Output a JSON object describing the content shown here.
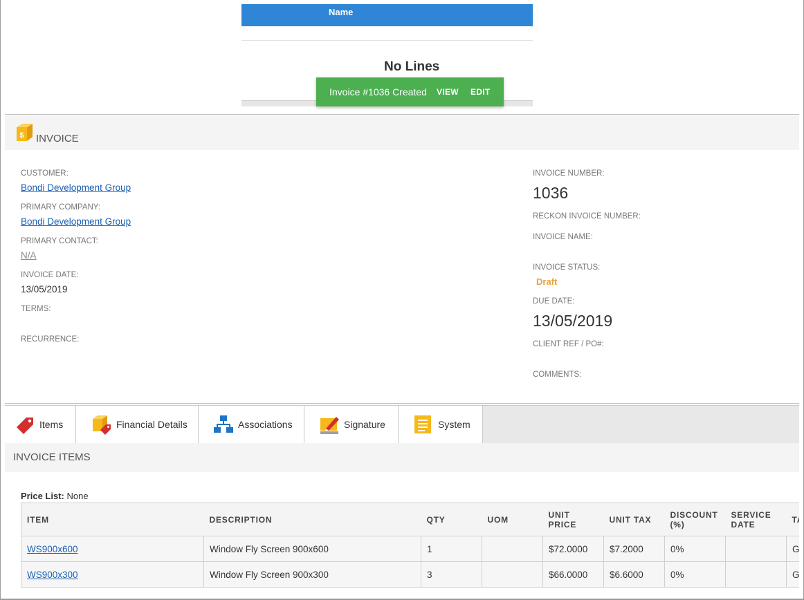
{
  "top_panel": {
    "name_header": "Name",
    "empty_message": "No Lines"
  },
  "toast": {
    "message": "Invoice #1036 Created",
    "view_label": "VIEW",
    "edit_label": "EDIT",
    "color": "#4caf50"
  },
  "invoice": {
    "section_title": "INVOICE",
    "icon": "invoice-box-icon",
    "left_fields": {
      "customer_label": "CUSTOMER:",
      "customer_value": "Bondi Development Group",
      "primary_company_label": "PRIMARY COMPANY:",
      "primary_company_value": "Bondi Development Group",
      "primary_contact_label": "PRIMARY CONTACT:",
      "primary_contact_value": "N/A",
      "invoice_date_label": "INVOICE DATE:",
      "invoice_date_value": "13/05/2019",
      "terms_label": "TERMS:",
      "recurrence_label": "RECURRENCE:"
    },
    "right_fields": {
      "invoice_number_label": "INVOICE NUMBER:",
      "invoice_number_value": "1036",
      "reckon_label": "RECKON INVOICE NUMBER:",
      "invoice_name_label": "INVOICE NAME:",
      "status_label": "INVOICE STATUS:",
      "status_value": "Draft",
      "status_color": "#e8a13a",
      "due_date_label": "DUE DATE:",
      "due_date_value": "13/05/2019",
      "client_ref_label": "CLIENT REF / PO#:",
      "comments_label": "COMMENTS:"
    }
  },
  "tabs": [
    {
      "label": "Items",
      "icon": "price-tag-icon",
      "active": true
    },
    {
      "label": "Financial Details",
      "icon": "financial-box-icon",
      "active": false
    },
    {
      "label": "Associations",
      "icon": "hierarchy-icon",
      "active": false
    },
    {
      "label": "Signature",
      "icon": "signature-pen-icon",
      "active": false
    },
    {
      "label": "System",
      "icon": "system-list-icon",
      "active": false
    }
  ],
  "items_section": {
    "title": "INVOICE ITEMS",
    "price_list_label": "Price List:",
    "price_list_value": "None",
    "columns": [
      "ITEM",
      "DESCRIPTION",
      "QTY",
      "UOM",
      "UNIT PRICE",
      "UNIT TAX",
      "DISCOUNT (%)",
      "SERVICE DATE",
      "TAX"
    ],
    "rows": [
      {
        "item": "WS900x600",
        "description": "Window Fly Screen 900x600",
        "qty": "1",
        "uom": "",
        "unit_price": "$72.0000",
        "unit_tax": "$7.2000",
        "discount": "0%",
        "service_date": "",
        "tax": "GST"
      },
      {
        "item": "WS900x300",
        "description": "Window Fly Screen 900x300",
        "qty": "3",
        "uom": "",
        "unit_price": "$66.0000",
        "unit_tax": "$6.6000",
        "discount": "0%",
        "service_date": "",
        "tax": "GST"
      }
    ]
  },
  "colors": {
    "header_blue": "#2f86d6",
    "link": "#1a5fb4",
    "accent_red": "#d32f2f",
    "accent_yellow": "#f6b81a"
  }
}
